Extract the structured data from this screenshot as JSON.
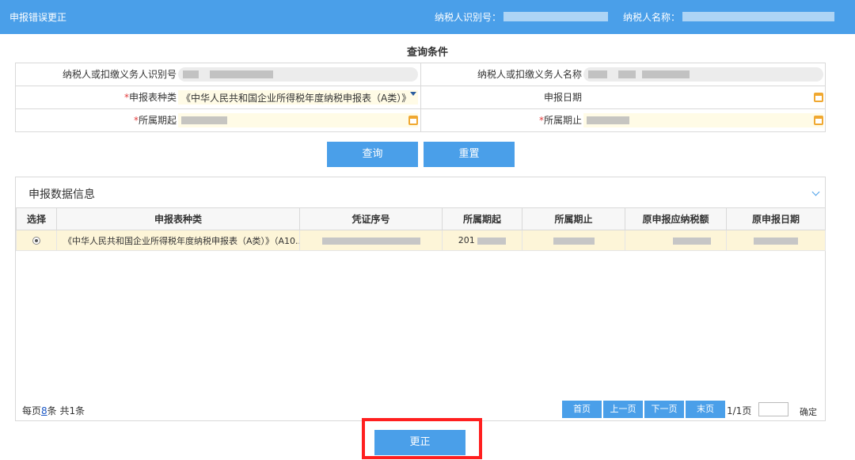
{
  "header": {
    "title": "申报错误更正",
    "taxpayer_id_label": "纳税人识别号：",
    "taxpayer_name_label": "纳税人名称："
  },
  "query": {
    "title": "查询条件",
    "fields": {
      "payer_id_label": "纳税人或扣缴义务人识别号",
      "payer_name_label": "纳税人或扣缴义务人名称",
      "form_type_label": "申报表种类",
      "form_type_value": "《中华人民共和国企业所得税年度纳税申报表（A类）》",
      "declare_date_label": "申报日期",
      "period_start_label": "所属期起",
      "period_end_label": "所属期止",
      "required_mark": "*"
    },
    "query_button": "查询",
    "reset_button": "重置"
  },
  "data_panel": {
    "title": "申报数据信息",
    "columns": [
      "选择",
      "申报表种类",
      "凭证序号",
      "所属期起",
      "所属期止",
      "原申报应纳税额",
      "原申报日期"
    ],
    "rows": [
      {
        "form_type": "《中华人民共和国企业所得税年度纳税申报表（A类）》（A10...",
        "period_start_prefix": "201"
      }
    ]
  },
  "pager": {
    "per_page_prefix": "每页",
    "per_page_count": "8",
    "per_page_suffix": "条 共1条",
    "first": "首页",
    "prev": "上一页",
    "next": "下一页",
    "last": "末页",
    "page_status": "1/1页",
    "confirm": "确定"
  },
  "correct_button": "更正"
}
